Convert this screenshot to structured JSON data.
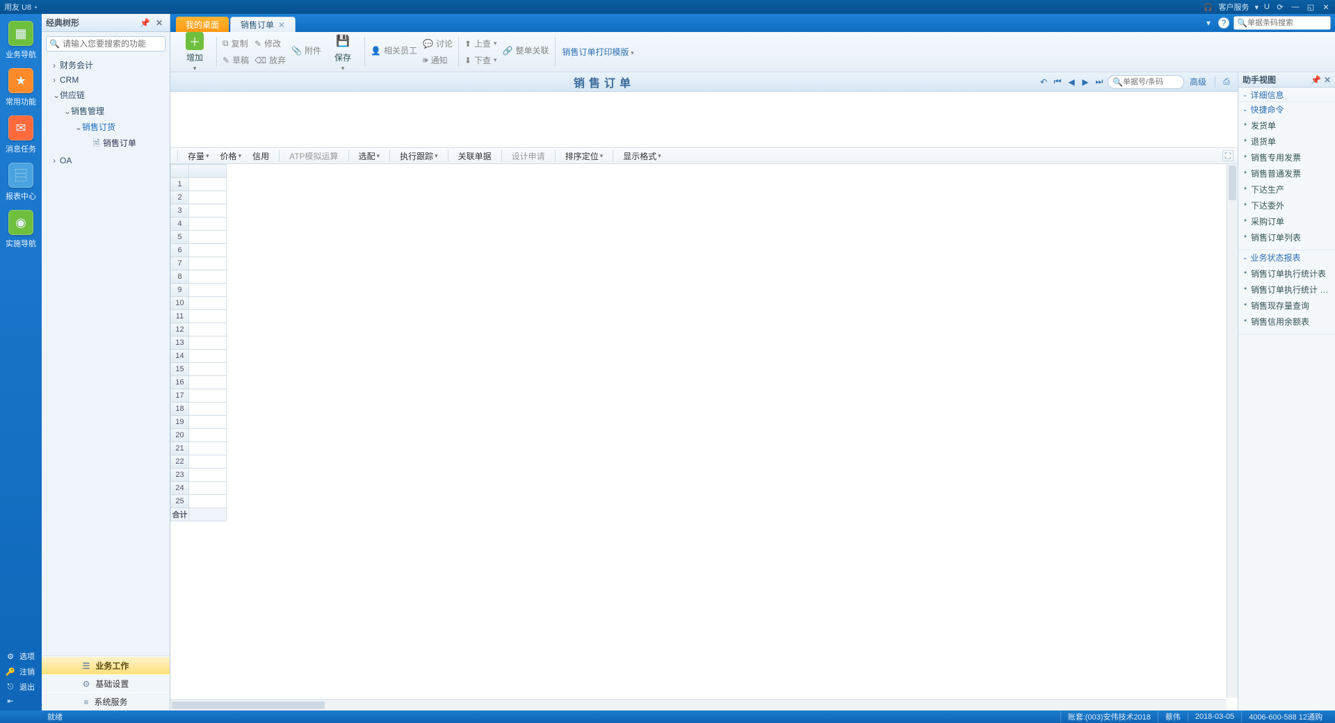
{
  "titlebar": {
    "brand": "用友 U8",
    "brand_sup": "+",
    "service": "客户服务",
    "u": "U"
  },
  "rail": {
    "items": [
      {
        "label": "业务导航",
        "color": "#6fbf3f"
      },
      {
        "label": "常用功能",
        "color": "#ff8a2a"
      },
      {
        "label": "消息任务",
        "color": "#ff6a3d"
      },
      {
        "label": "报表中心",
        "color": "#4aa3e0"
      },
      {
        "label": "实施导航",
        "color": "#6fbf3f"
      }
    ],
    "bottom": [
      {
        "icon": "⚙",
        "label": "选项"
      },
      {
        "icon": "🔑",
        "label": "注销"
      },
      {
        "icon": "⎋",
        "label": "退出"
      }
    ],
    "collapse": "⇤"
  },
  "nav": {
    "title": "经典树形",
    "search_placeholder": "请输入您要搜索的功能",
    "tree": [
      {
        "lvl": 1,
        "caret": "›",
        "label": "财务会计"
      },
      {
        "lvl": 1,
        "caret": "›",
        "label": "CRM"
      },
      {
        "lvl": 1,
        "caret": "⌄",
        "label": "供应链"
      },
      {
        "lvl": 2,
        "caret": "⌄",
        "label": "销售管理"
      },
      {
        "lvl": 3,
        "caret": "⌄",
        "label": "销售订货",
        "sel": true
      },
      {
        "lvl": 4,
        "caret": "",
        "label": "销售订单",
        "doc": true
      },
      {
        "lvl": 1,
        "caret": "›",
        "label": "OA"
      }
    ],
    "tabs": [
      {
        "label": "业务工作",
        "active": true,
        "icon": "☰"
      },
      {
        "label": "基础设置",
        "active": false,
        "icon": "⚙"
      },
      {
        "label": "系统服务",
        "active": false,
        "icon": "≡"
      }
    ]
  },
  "maintabs": {
    "home": "我的桌面",
    "doc": "销售订单",
    "barcode_placeholder": "单据条码搜索"
  },
  "ribbon": {
    "add": "增加",
    "copy": "复制",
    "modify": "修改",
    "attach": "附件",
    "draft": "草稿",
    "discard": "放弃",
    "save": "保存",
    "related": "相关员工",
    "discuss": "讨论",
    "notify": "通知",
    "up": "上查",
    "down": "下查",
    "link": "整单关联",
    "template": "销售订单打印模版"
  },
  "docbar": {
    "title": "销售订单",
    "search_placeholder": "单据号/条码",
    "advanced": "高级"
  },
  "gridbar": {
    "stock": "存量",
    "price": "价格",
    "credit": "信用",
    "atp": "ATP模拟运算",
    "match": "选配",
    "track": "执行跟踪",
    "assoc": "关联单据",
    "design": "设计申请",
    "sort": "排序定位",
    "display": "显示格式"
  },
  "grid": {
    "rows": 25,
    "footer": "合计"
  },
  "assist": {
    "title": "助手视图",
    "sec_detail": "详细信息",
    "sec_quick": "快捷命令",
    "quick_items": [
      "发货单",
      "退货单",
      "销售专用发票",
      "销售普通发票",
      "下达生产",
      "下达委外",
      "采购订单",
      "销售订单列表"
    ],
    "sec_report": "业务状态报表",
    "report_items": [
      "销售订单执行统计表",
      "销售订单执行统计 …",
      "销售现存量查询",
      "销售信用余额表"
    ]
  },
  "status": {
    "ready": "就绪",
    "account": "账套:(003)安伟技术2018",
    "user": "蔡伟",
    "date": "2018-03-05",
    "hotline": "4006-600-588 12通购"
  }
}
